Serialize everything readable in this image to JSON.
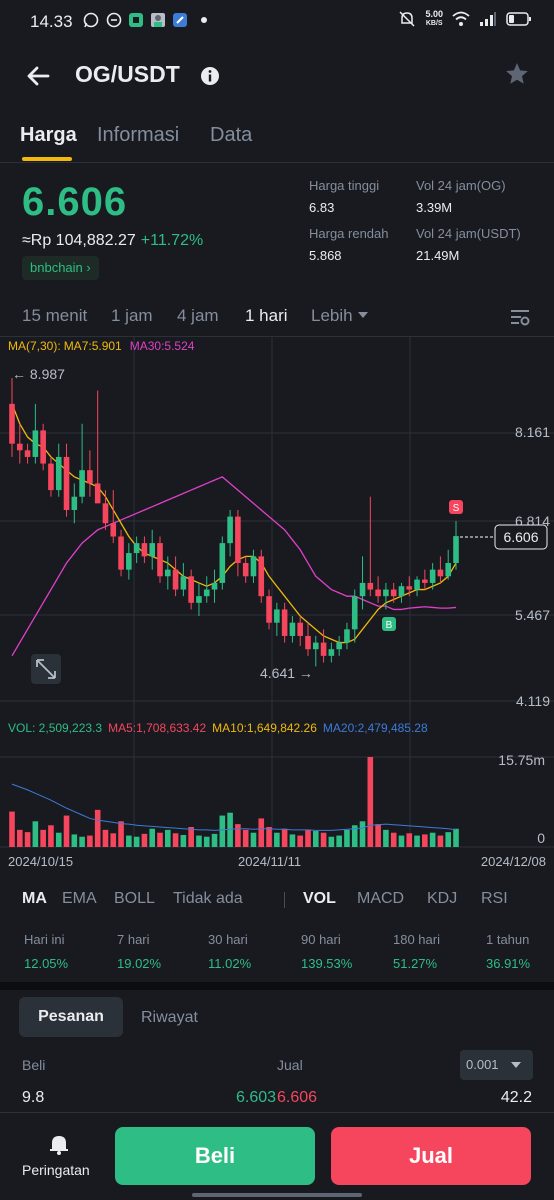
{
  "status_bar": {
    "time": "14.33",
    "net_speed_value": "5.00",
    "net_speed_unit": "KB/S"
  },
  "header": {
    "title": "OG/USDT"
  },
  "tabs": [
    {
      "label": "Harga"
    },
    {
      "label": "Informasi"
    },
    {
      "label": "Data"
    }
  ],
  "price": {
    "last": "6.606",
    "approx": "≈Rp 104,882.27",
    "change": "+11.72%",
    "chain": "bnbchain"
  },
  "stats": {
    "high_label": "Harga tinggi",
    "high_value": "6.83",
    "low_label": "Harga rendah",
    "low_value": "5.868",
    "vol_base_label": "Vol 24 jam(OG)",
    "vol_base_value": "3.39M",
    "vol_quote_label": "Vol 24 jam(USDT)",
    "vol_quote_value": "21.49M"
  },
  "intervals": [
    "15 menit",
    "1 jam",
    "4 jam",
    "1 hari",
    "Lebih"
  ],
  "chart": {
    "ma_legend": {
      "ma_label": "MA(7,30):",
      "ma7": "MA7:5.901",
      "ma30": "MA30:5.524"
    },
    "vol_legend": {
      "vol": "VOL: 2,509,223.3",
      "ma5": "MA5:1,708,633.42",
      "ma10": "MA10:1,649,842.26",
      "ma20": "MA20:2,479,485.28"
    },
    "price_axis": [
      "8.161",
      "6.814",
      "5.467",
      "4.119"
    ],
    "volume_axis": [
      "15.75m",
      "0"
    ],
    "high_marker": "← 8.987",
    "low_marker": "4.641 →",
    "current_price_tag": "6.606",
    "buy_marker": "B",
    "sell_marker": "S",
    "dates": [
      "2024/10/15",
      "2024/11/11",
      "2024/12/08"
    ],
    "colors": {
      "up": "#2ebd85",
      "down": "#f6465d",
      "ma7": "#f0b90b",
      "ma30": "#e040c8",
      "vol_ma20": "#3e7bd6"
    }
  },
  "chart_data": {
    "type": "candlestick",
    "x_start": "2024/10/14",
    "x_end": "2024/12/08",
    "ylim": [
      4.119,
      9.0
    ],
    "candles": [
      [
        8.6,
        8.99,
        7.8,
        8.0
      ],
      [
        8.0,
        8.3,
        7.7,
        7.9
      ],
      [
        7.9,
        8.0,
        7.7,
        7.8
      ],
      [
        7.8,
        8.6,
        7.7,
        8.2
      ],
      [
        8.2,
        8.3,
        7.6,
        7.7
      ],
      [
        7.7,
        7.8,
        7.2,
        7.3
      ],
      [
        7.3,
        8.0,
        7.2,
        7.8
      ],
      [
        7.8,
        8.0,
        6.9,
        7.0
      ],
      [
        7.0,
        7.4,
        6.8,
        7.2
      ],
      [
        7.2,
        8.3,
        7.1,
        7.6
      ],
      [
        7.6,
        7.9,
        7.2,
        7.4
      ],
      [
        7.4,
        8.8,
        7.3,
        7.1
      ],
      [
        7.1,
        7.3,
        6.7,
        6.8
      ],
      [
        6.8,
        7.3,
        6.5,
        6.6
      ],
      [
        6.6,
        6.7,
        6.0,
        6.1
      ],
      [
        6.1,
        6.5,
        5.95,
        6.35
      ],
      [
        6.35,
        6.6,
        6.2,
        6.5
      ],
      [
        6.5,
        6.6,
        6.2,
        6.3
      ],
      [
        6.3,
        6.7,
        6.1,
        6.5
      ],
      [
        6.5,
        6.6,
        5.9,
        6.0
      ],
      [
        6.0,
        6.3,
        5.8,
        6.1
      ],
      [
        6.1,
        6.3,
        5.7,
        5.8
      ],
      [
        5.8,
        6.2,
        5.7,
        6.0
      ],
      [
        6.0,
        6.1,
        5.5,
        5.6
      ],
      [
        5.6,
        5.9,
        5.4,
        5.7
      ],
      [
        5.7,
        6.0,
        5.6,
        5.8
      ],
      [
        5.8,
        6.1,
        5.6,
        5.9
      ],
      [
        5.9,
        6.6,
        5.8,
        6.5
      ],
      [
        6.5,
        7.0,
        6.3,
        6.9
      ],
      [
        6.9,
        7.0,
        6.0,
        6.2
      ],
      [
        6.2,
        6.3,
        5.9,
        6.0
      ],
      [
        6.0,
        6.4,
        5.9,
        6.3
      ],
      [
        6.3,
        6.4,
        5.6,
        5.7
      ],
      [
        5.7,
        5.8,
        5.2,
        5.3
      ],
      [
        5.3,
        5.6,
        5.1,
        5.5
      ],
      [
        5.5,
        5.6,
        5.0,
        5.1
      ],
      [
        5.1,
        5.4,
        5.0,
        5.3
      ],
      [
        5.3,
        5.4,
        4.95,
        5.1
      ],
      [
        5.1,
        5.3,
        4.8,
        4.9
      ],
      [
        4.9,
        5.1,
        4.641,
        5.0
      ],
      [
        5.0,
        5.2,
        4.7,
        4.8
      ],
      [
        4.8,
        5.0,
        4.7,
        4.9
      ],
      [
        4.9,
        5.1,
        4.8,
        5.0
      ],
      [
        5.0,
        5.3,
        4.9,
        5.2
      ],
      [
        5.2,
        5.8,
        5.0,
        5.7
      ],
      [
        5.7,
        6.3,
        5.5,
        5.9
      ],
      [
        5.9,
        7.2,
        5.7,
        5.8
      ],
      [
        5.8,
        6.0,
        5.6,
        5.7
      ],
      [
        5.7,
        5.9,
        5.5,
        5.8
      ],
      [
        5.8,
        5.9,
        5.6,
        5.7
      ],
      [
        5.7,
        5.9,
        5.6,
        5.85
      ],
      [
        5.85,
        6.0,
        5.7,
        5.8
      ],
      [
        5.8,
        6.0,
        5.7,
        5.95
      ],
      [
        5.95,
        6.1,
        5.8,
        5.9
      ],
      [
        5.9,
        6.2,
        5.8,
        6.1
      ],
      [
        6.1,
        6.3,
        5.9,
        6.0
      ],
      [
        6.0,
        6.4,
        5.95,
        6.2
      ],
      [
        6.2,
        6.83,
        6.1,
        6.606
      ]
    ],
    "ma7": [
      8.6,
      8.3,
      8.1,
      8.0,
      7.95,
      7.8,
      7.7,
      7.6,
      7.5,
      7.45,
      7.4,
      7.35,
      7.2,
      7.0,
      6.8,
      6.6,
      6.45,
      6.35,
      6.3,
      6.25,
      6.2,
      6.1,
      6.0,
      5.95,
      5.9,
      5.85,
      5.9,
      6.0,
      6.15,
      6.25,
      6.3,
      6.3,
      6.2,
      6.0,
      5.85,
      5.7,
      5.55,
      5.4,
      5.3,
      5.2,
      5.1,
      5.05,
      5.0,
      5.0,
      5.05,
      5.2,
      5.35,
      5.5,
      5.6,
      5.65,
      5.7,
      5.75,
      5.8,
      5.8,
      5.85,
      5.9,
      6.0,
      6.2
    ],
    "ma30": [
      4.8,
      5.0,
      5.2,
      5.4,
      5.6,
      5.8,
      6.0,
      6.2,
      6.35,
      6.5,
      6.6,
      6.7,
      6.75,
      6.8,
      6.85,
      6.9,
      6.95,
      7.0,
      7.05,
      7.1,
      7.15,
      7.2,
      7.25,
      7.3,
      7.35,
      7.4,
      7.45,
      7.5,
      7.4,
      7.3,
      7.2,
      7.1,
      7.0,
      6.9,
      6.8,
      6.7,
      6.55,
      6.4,
      6.2,
      6.0,
      5.9,
      5.8,
      5.75,
      5.7,
      5.7,
      5.65,
      5.6,
      5.55,
      5.55,
      5.5,
      5.5,
      5.52,
      5.53,
      5.54,
      5.53,
      5.52,
      5.52,
      5.53
    ],
    "volume": [
      6.2,
      3.0,
      2.6,
      4.5,
      3.0,
      3.8,
      2.5,
      5.5,
      2.2,
      1.8,
      2.0,
      6.5,
      3.0,
      2.4,
      4.5,
      2.0,
      1.8,
      2.3,
      3.2,
      2.5,
      3.0,
      2.4,
      2.1,
      3.5,
      2.0,
      1.8,
      2.3,
      5.5,
      6.0,
      4.0,
      3.0,
      2.5,
      5.0,
      3.5,
      2.5,
      3.2,
      2.2,
      2.0,
      3.0,
      2.8,
      2.5,
      1.8,
      2.0,
      3.0,
      3.8,
      4.5,
      15.75,
      4.0,
      3.0,
      2.5,
      2.0,
      2.4,
      2.0,
      2.2,
      2.5,
      2.0,
      2.6,
      3.2
    ],
    "volume_ylim": [
      0,
      15.75
    ],
    "vol_ma20": [
      11,
      10.5,
      10,
      9.4,
      8.8,
      8.2,
      7.5,
      6.8,
      6.2,
      5.6,
      5.0,
      4.7,
      4.5,
      4.3,
      4.1,
      4.0,
      3.8,
      3.7,
      3.6,
      3.5,
      3.4,
      3.3,
      3.2,
      3.1,
      3.0,
      3.0,
      2.9,
      3.0,
      3.1,
      3.2,
      3.2,
      3.1,
      3.2,
      3.2,
      3.1,
      3.1,
      3.0,
      3.0,
      3.0,
      2.9,
      2.9,
      2.9,
      3.0,
      3.1,
      3.2,
      3.3,
      3.8,
      3.9,
      4.0,
      3.9,
      3.8,
      3.7,
      3.6,
      3.5,
      3.4,
      3.3,
      3.2,
      3.0
    ]
  },
  "indicators_main": [
    "MA",
    "EMA",
    "BOLL",
    "Tidak ada"
  ],
  "indicators_sub": [
    "VOL",
    "MACD",
    "KDJ",
    "RSI"
  ],
  "performance": [
    {
      "label": "Hari ini",
      "value": "12.05%"
    },
    {
      "label": "7 hari",
      "value": "19.02%"
    },
    {
      "label": "30 hari",
      "value": "11.02%"
    },
    {
      "label": "90 hari",
      "value": "139.53%"
    },
    {
      "label": "180 hari",
      "value": "51.27%"
    },
    {
      "label": "1 tahun",
      "value": "36.91%"
    }
  ],
  "orders": {
    "tab_orders": "Pesanan",
    "tab_history": "Riwayat",
    "col_buy": "Beli",
    "col_sell": "Jual",
    "precision": "0.001",
    "bid_qty": "9.8",
    "bid_price": "6.603",
    "ask_price": "6.606",
    "ask_qty": "42.2"
  },
  "bottom": {
    "alert_label": "Peringatan",
    "buy_label": "Beli",
    "sell_label": "Jual"
  }
}
